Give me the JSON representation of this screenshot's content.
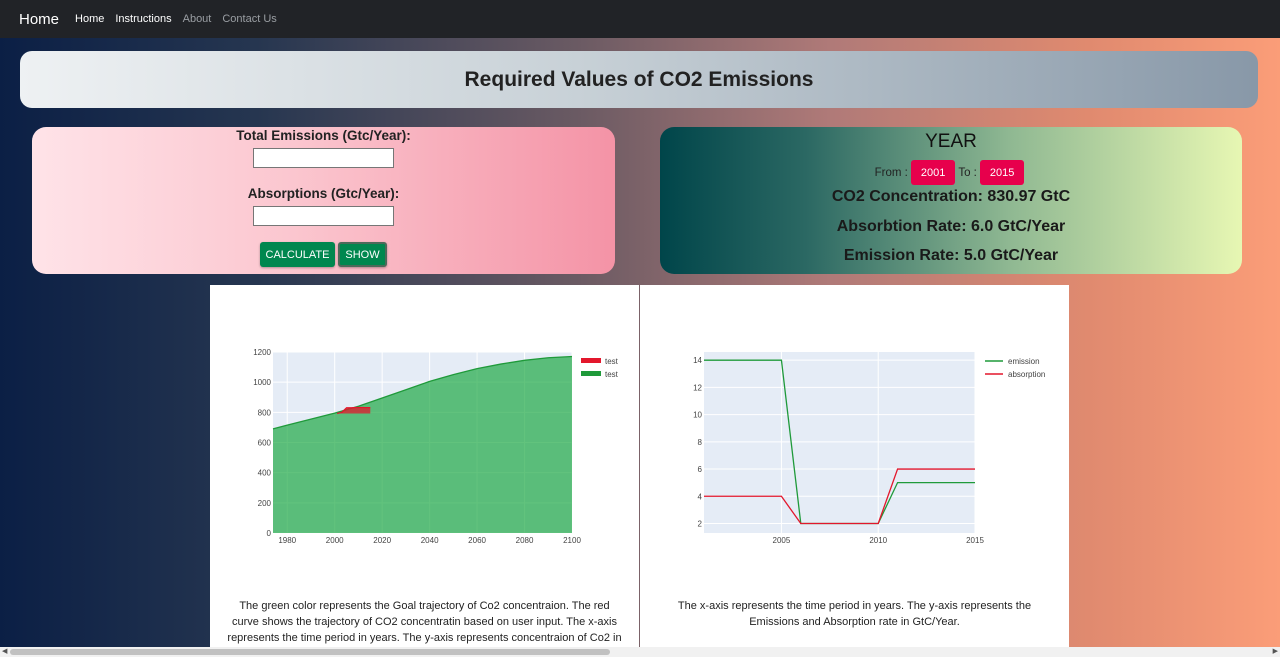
{
  "navbar": {
    "brand": "Home",
    "links": [
      "Home",
      "Instructions",
      "About",
      "Contact Us"
    ]
  },
  "header": {
    "title": "Required Values of CO2 Emissions"
  },
  "input_form": {
    "total_label": "Total Emissions (Gtc/Year):",
    "total_value": "",
    "absorption_label": "Absorptions (Gtc/Year):",
    "absorption_value": "",
    "calculate_label": "CALCULATE",
    "show_label": "SHOW"
  },
  "year_panel": {
    "title": "YEAR",
    "from_label": "From :",
    "from_value": "2001",
    "to_label": "To :",
    "to_value": "2015",
    "concentration": "CO2 Concentration: 830.97 GtC",
    "absorption_rate": "Absorbtion Rate: 6.0 GtC/Year",
    "emission_rate": "Emission Rate: 5.0 GtC/Year"
  },
  "colors": {
    "goal_green": "#1f9a3a",
    "user_red": "#e3172c",
    "brand_pill": "#e7004c",
    "button_green": "#00874f"
  },
  "chart_data": [
    {
      "type": "area",
      "title": "",
      "xlabel": "",
      "ylabel": "",
      "xlim": [
        1974,
        2100
      ],
      "ylim": [
        0,
        1200
      ],
      "xticks": [
        1980,
        2000,
        2020,
        2040,
        2060,
        2080,
        2100
      ],
      "yticks": [
        0,
        200,
        400,
        600,
        800,
        1000,
        1200
      ],
      "grid": true,
      "legend": "top-right",
      "series": [
        {
          "name": "test",
          "color": "#e3172c",
          "x": [
            2001,
            2003,
            2005,
            2007,
            2009,
            2011,
            2013,
            2015
          ],
          "y": [
            792,
            800,
            830,
            830,
            832,
            832,
            831,
            831
          ]
        },
        {
          "name": "test",
          "color": "#1f9a3a",
          "x": [
            1974,
            1980,
            1990,
            2000,
            2010,
            2020,
            2030,
            2040,
            2050,
            2060,
            2070,
            2080,
            2090,
            2100
          ],
          "y": [
            690,
            715,
            755,
            795,
            840,
            895,
            950,
            1005,
            1050,
            1090,
            1120,
            1145,
            1162,
            1170
          ]
        }
      ]
    },
    {
      "type": "line",
      "title": "",
      "xlabel": "",
      "ylabel": "",
      "xlim": [
        2001,
        2015
      ],
      "ylim": [
        1.3,
        14.6
      ],
      "xticks": [
        2005,
        2010,
        2015
      ],
      "yticks": [
        2,
        4,
        6,
        8,
        10,
        12,
        14
      ],
      "grid": true,
      "legend": "top-right",
      "series": [
        {
          "name": "emission",
          "color": "#1f9a3a",
          "x": [
            2001,
            2005,
            2006,
            2010,
            2011,
            2015
          ],
          "y": [
            14,
            14,
            2,
            2,
            5,
            5
          ]
        },
        {
          "name": "absorption",
          "color": "#e3172c",
          "x": [
            2001,
            2005,
            2006,
            2010,
            2011,
            2015
          ],
          "y": [
            4,
            4,
            2,
            2,
            6,
            6
          ]
        }
      ]
    }
  ],
  "captions": {
    "left": "The green color represents the Goal trajectory of Co2 concentraion. The red curve shows the trajectory of CO2 concentratin based on user input. The x-axis represents the time period in years. The y-axis represents concentraion of Co2 in",
    "right": "The x-axis represents the time period in years. The y-axis represents the Emissions and Absorption rate in GtC/Year."
  }
}
